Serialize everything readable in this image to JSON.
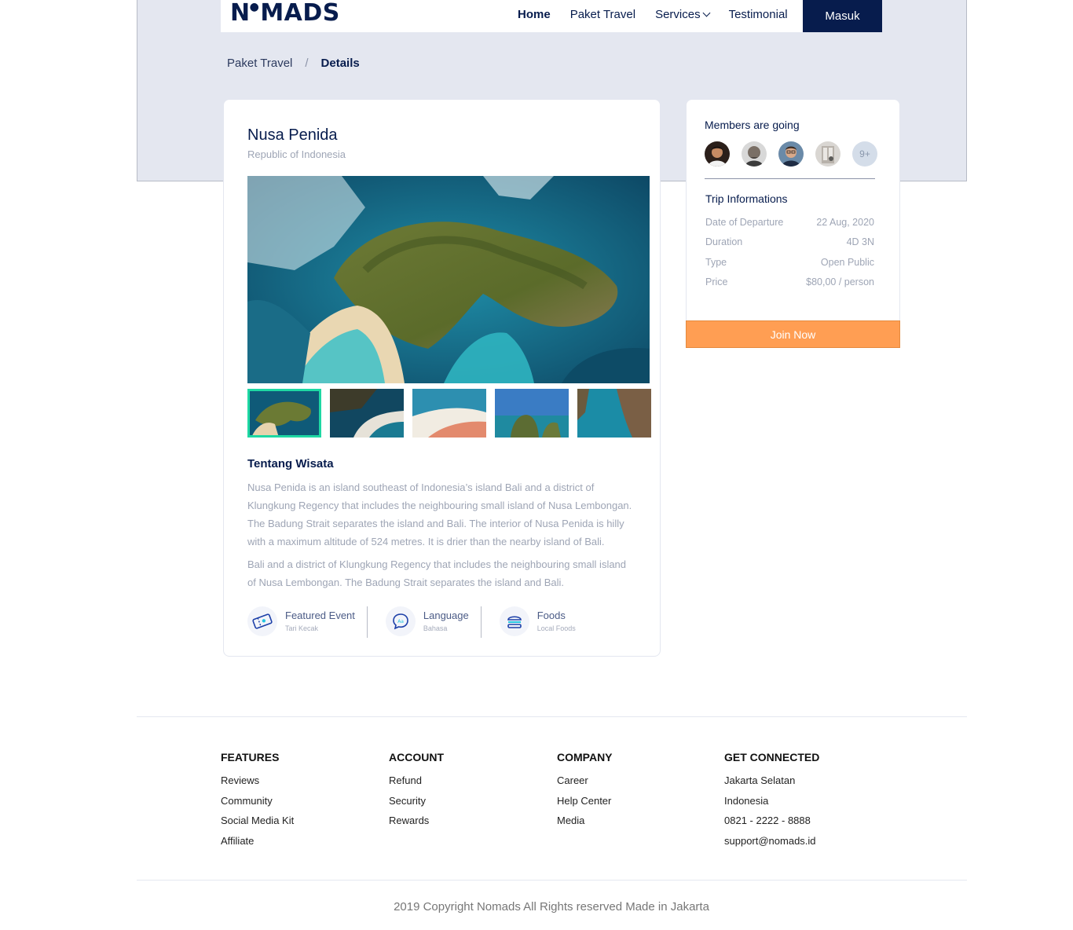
{
  "brand": {
    "logo": "NOMADS"
  },
  "nav": {
    "home": "Home",
    "paket": "Paket Travel",
    "services": "Services",
    "testimonial": "Testimonial",
    "login": "Masuk"
  },
  "breadcrumb": {
    "parent": "Paket Travel",
    "separator": "/",
    "current": "Details"
  },
  "detail": {
    "title": "Nusa Penida",
    "location": "Republic of Indonesia",
    "about_title": "Tentang Wisata",
    "about_p1": "Nusa Penida is an island southeast of Indonesia’s island Bali and a district of Klungkung Regency that includes the neighbouring small island of Nusa Lembongan. The Badung Strait separates the island and Bali. The interior of Nusa Penida is hilly with a maximum altitude of 524 metres. It is drier than the nearby island of Bali.",
    "about_p2": "Bali and a district of Klungkung Regency that includes the neighbouring small island of Nusa Lembongan. The Badung Strait separates the island and Bali.",
    "features": [
      {
        "label": "Featured Event",
        "value": "Tari Kecak",
        "icon": "ticket-icon"
      },
      {
        "label": "Language",
        "value": "Bahasa",
        "icon": "chat-bubble-icon"
      },
      {
        "label": "Foods",
        "value": "Local Foods",
        "icon": "burger-icon"
      }
    ]
  },
  "sidebar": {
    "members_title": "Members are going",
    "more_members": "9+",
    "trip_title": "Trip Informations",
    "rows": [
      {
        "label": "Date of Departure",
        "value": "22 Aug, 2020"
      },
      {
        "label": "Duration",
        "value": "4D 3N"
      },
      {
        "label": "Type",
        "value": "Open Public"
      },
      {
        "label": "Price",
        "value": "$80,00 / person"
      }
    ],
    "join": "Join Now"
  },
  "footer": {
    "features": {
      "title": "FEATURES",
      "links": [
        "Reviews",
        "Community",
        "Social Media Kit",
        "Affiliate"
      ]
    },
    "account": {
      "title": "ACCOUNT",
      "links": [
        "Refund",
        "Security",
        "Rewards"
      ]
    },
    "company": {
      "title": "COMPANY",
      "links": [
        "Career",
        "Help Center",
        "Media"
      ]
    },
    "connected": {
      "title": "GET CONNECTED",
      "links": [
        "Jakarta Selatan",
        "Indonesia",
        "0821 - 2222 - 8888",
        "support@nomads.id"
      ]
    },
    "copyright": "2019 Copyright Nomads All Rights reserved Made in Jakarta"
  },
  "colors": {
    "primary": "#071C4D",
    "accent": "#FF9E53",
    "highlight": "#1ED8A3",
    "hero": "#E4E7F0"
  }
}
